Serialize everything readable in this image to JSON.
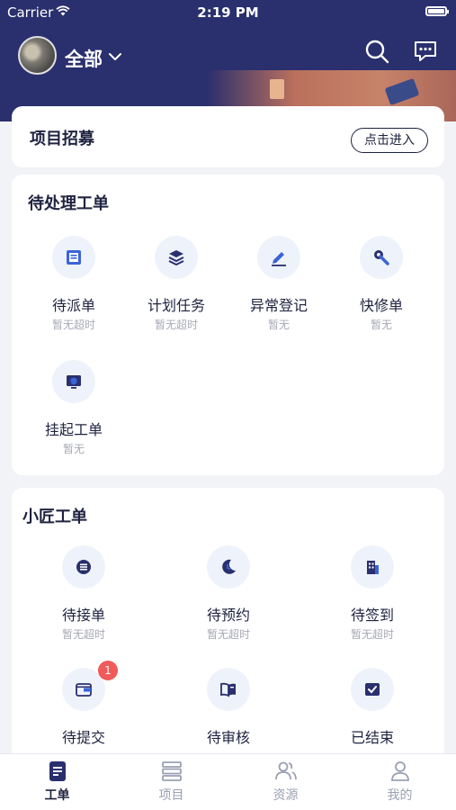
{
  "status": {
    "carrier": "Carrier",
    "time": "2:19 PM"
  },
  "header": {
    "scope": "全部"
  },
  "recruit": {
    "title": "项目招募",
    "enter": "点击进入"
  },
  "pending": {
    "title": "待处理工单",
    "items": [
      {
        "label": "待派单",
        "sub": "暂无超时",
        "icon": "document-icon"
      },
      {
        "label": "计划任务",
        "sub": "暂无超时",
        "icon": "layers-icon"
      },
      {
        "label": "异常登记",
        "sub": "暂无",
        "icon": "pen-icon"
      },
      {
        "label": "快修单",
        "sub": "暂无",
        "icon": "wrench-icon"
      },
      {
        "label": "挂起工单",
        "sub": "暂无",
        "icon": "monitor-shield-icon"
      }
    ]
  },
  "craft": {
    "title": "小匠工单",
    "items": [
      {
        "label": "待接单",
        "sub": "暂无超时",
        "icon": "list-circle-icon"
      },
      {
        "label": "待预约",
        "sub": "暂无超时",
        "icon": "moon-clock-icon"
      },
      {
        "label": "待签到",
        "sub": "暂无超时",
        "icon": "building-icon"
      },
      {
        "label": "待提交",
        "sub": "",
        "icon": "wallet-icon",
        "badge": "1"
      },
      {
        "label": "待审核",
        "sub": "",
        "icon": "book-icon"
      },
      {
        "label": "已结束",
        "sub": "",
        "icon": "check-box-icon"
      }
    ]
  },
  "tabs": [
    {
      "label": "工单",
      "icon": "workorder-icon",
      "active": true
    },
    {
      "label": "项目",
      "icon": "server-icon"
    },
    {
      "label": "资源",
      "icon": "users-icon"
    },
    {
      "label": "我的",
      "icon": "person-icon"
    }
  ],
  "colors": {
    "header": "#2a2f6e",
    "badge": "#f05a5a",
    "iconBlue": "#3b64d8"
  }
}
